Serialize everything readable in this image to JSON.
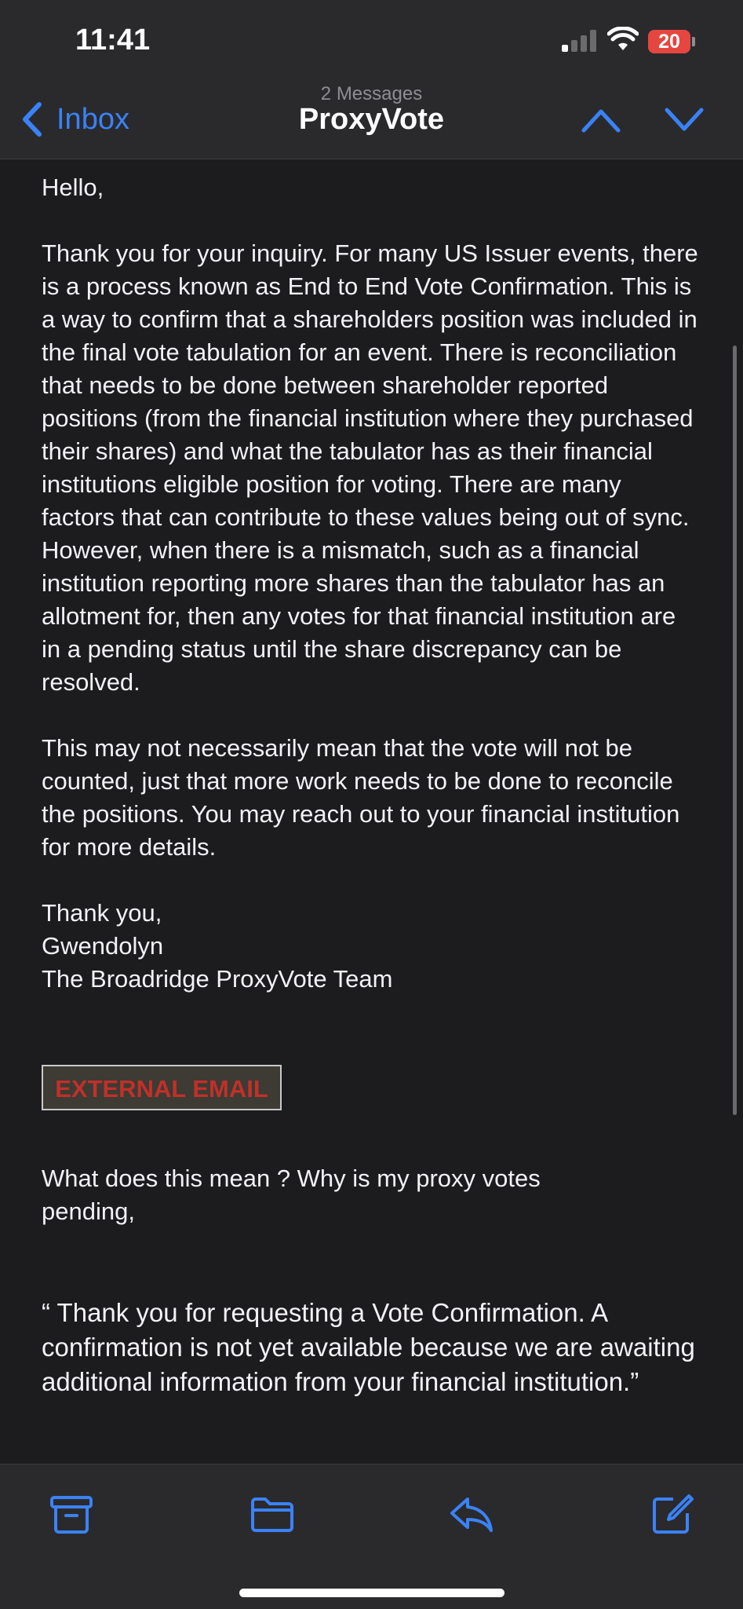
{
  "status_bar": {
    "time": "11:41",
    "battery": "20"
  },
  "nav": {
    "back_label": "Inbox",
    "subtitle": "2 Messages",
    "title": "ProxyVote"
  },
  "email": {
    "greeting": "Hello,",
    "paragraph1": "Thank you for your inquiry.  For many US Issuer events, there is a process known as End to End Vote Confirmation.  This is a way to confirm that a shareholders position was included in the final vote tabulation for an event.  There is reconciliation that needs to be done between shareholder reported positions (from the financial institution where they purchased their shares) and what the tabulator has as their financial institutions eligible position for voting. There are many factors that can contribute to these values being out of sync.  However, when there is a mismatch, such as a financial institution reporting more shares than the tabulator has an allotment for, then any votes for that financial institution are in a pending status until the share discrepancy can be resolved.",
    "paragraph2": "This may not necessarily mean that the vote will not be counted, just that more work needs to be done to reconcile the positions.  You may reach out to your financial institution for more details.",
    "signoff": "Thank you,",
    "signature_name": "Gwendolyn",
    "signature_team": "The Broadridge ProxyVote Team",
    "external_badge": "EXTERNAL EMAIL",
    "quoted_question": "What does this mean ?   Why is my proxy votes\npending,",
    "quoted_text": "“ Thank you for requesting a Vote Confirmation. A confirmation is not yet available because we are awaiting additional information from your financial institution.”"
  },
  "colors": {
    "accent": "#3b82f6",
    "background": "#1c1c1e",
    "battery_low": "#e5463f",
    "external_badge_text": "#c0302a"
  },
  "toolbar_icons": [
    "archive-icon",
    "folder-icon",
    "reply-icon",
    "compose-icon"
  ]
}
